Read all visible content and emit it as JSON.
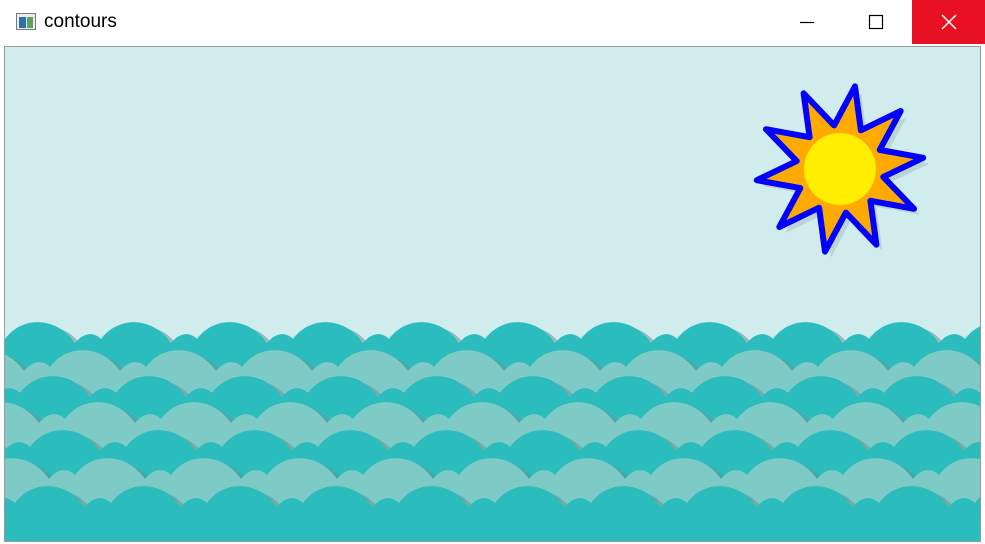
{
  "window": {
    "title": "contours",
    "icon": "app-window-icon",
    "controls": [
      {
        "name": "minimize",
        "icon": "minimize-icon"
      },
      {
        "name": "maximize",
        "icon": "maximize-icon"
      },
      {
        "name": "close",
        "icon": "close-icon"
      }
    ]
  },
  "colors": {
    "close_button_bg": "#e81123",
    "sky": "#d0ecec",
    "wave_dark": "#2bbcbd",
    "wave_light": "#7dcac6",
    "wave_shadow": "#6f8f8f",
    "sun_fill": "#ffee00",
    "sun_ray_fill": "#ffaa00",
    "sun_contour": "#0000ff"
  },
  "canvas": {
    "content": "image-display",
    "sun_icon": "sun-icon",
    "waves_icon": "waves-icon"
  }
}
